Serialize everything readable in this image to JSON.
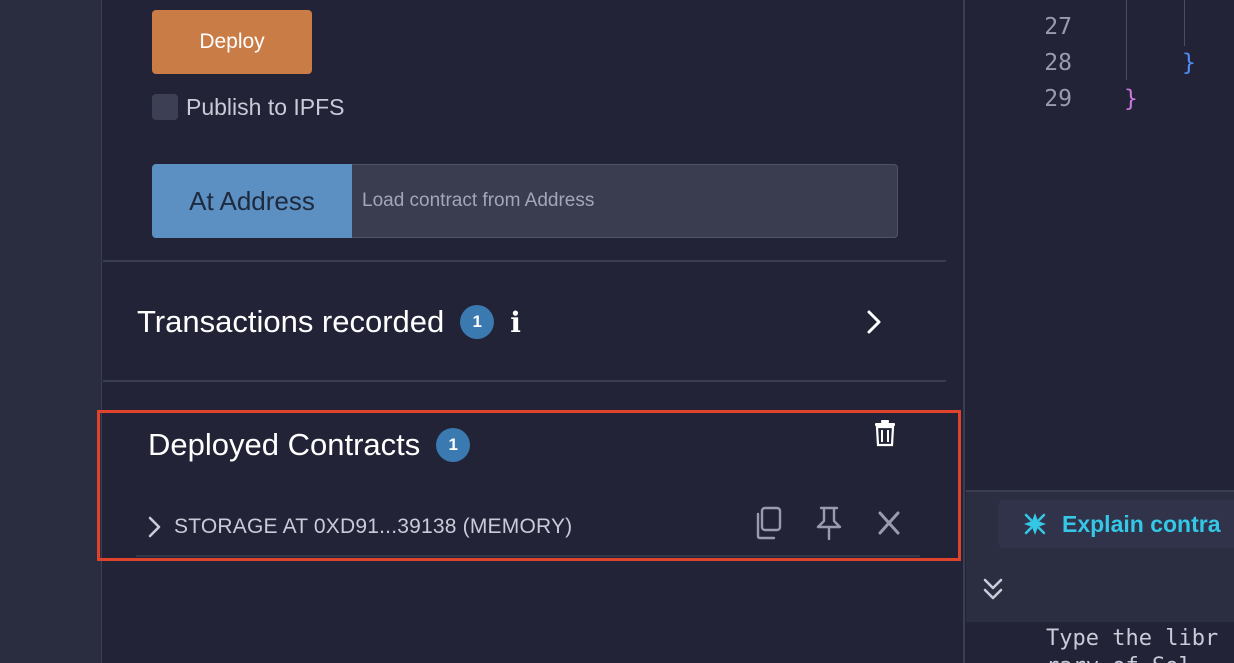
{
  "deploy": {
    "label": "Deploy"
  },
  "publish": {
    "label": "Publish to IPFS",
    "checked": false
  },
  "at_address": {
    "button_label": "At Address",
    "placeholder": "Load contract from Address"
  },
  "transactions": {
    "title": "Transactions recorded",
    "count": "1",
    "info_glyph": "i"
  },
  "deployed": {
    "title": "Deployed Contracts",
    "count": "1",
    "instances": [
      {
        "label": "STORAGE AT 0XD91...39138 (MEMORY)"
      }
    ]
  },
  "editor": {
    "lines": [
      {
        "number": "27",
        "text": ""
      },
      {
        "number": "28",
        "text": "}"
      },
      {
        "number": "29",
        "text": "}"
      }
    ]
  },
  "ai": {
    "explain_label": "Explain contra"
  },
  "terminal": {
    "line1": "Type the libr",
    "line2": "rary of Sol"
  },
  "colors": {
    "deploy": "#c97c46",
    "at_address": "#5c8fc2",
    "badge": "#3b7ab0",
    "highlight": "#e0432c",
    "explain": "#34c8e6"
  }
}
